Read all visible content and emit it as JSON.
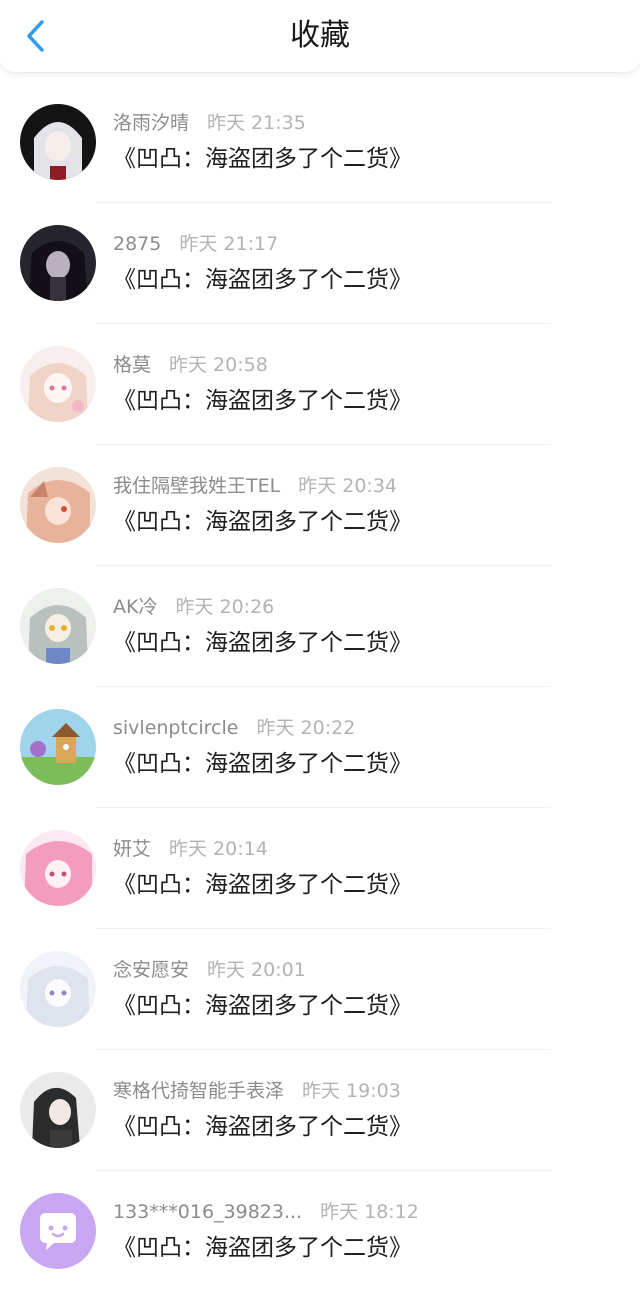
{
  "header": {
    "title": "收藏",
    "back_icon": "chevron-left-icon"
  },
  "accent_color": "#2f9bf3",
  "items": [
    {
      "name": "洛雨汐晴",
      "time": "昨天 21:35",
      "message": "《凹凸：海盗团多了个二货》"
    },
    {
      "name": "2875",
      "time": "昨天 21:17",
      "message": "《凹凸：海盗团多了个二货》"
    },
    {
      "name": "格莫",
      "time": "昨天 20:58",
      "message": "《凹凸：海盗团多了个二货》"
    },
    {
      "name": "我住隔壁我姓王TEL",
      "time": "昨天 20:34",
      "message": "《凹凸：海盗团多了个二货》"
    },
    {
      "name": "AK冷",
      "time": "昨天 20:26",
      "message": "《凹凸：海盗团多了个二货》"
    },
    {
      "name": "sivlenptcircle",
      "time": "昨天 20:22",
      "message": "《凹凸：海盗团多了个二货》"
    },
    {
      "name": "妍艾",
      "time": "昨天 20:14",
      "message": "《凹凸：海盗团多了个二货》"
    },
    {
      "name": "念安愿安",
      "time": "昨天 20:01",
      "message": "《凹凸：海盗团多了个二货》"
    },
    {
      "name": "寒格代掎智能手表泽",
      "time": "昨天 19:03",
      "message": "《凹凸：海盗团多了个二货》"
    },
    {
      "name": "133***016_39823...",
      "time": "昨天 18:12",
      "message": "《凹凸：海盗团多了个二货》"
    }
  ]
}
